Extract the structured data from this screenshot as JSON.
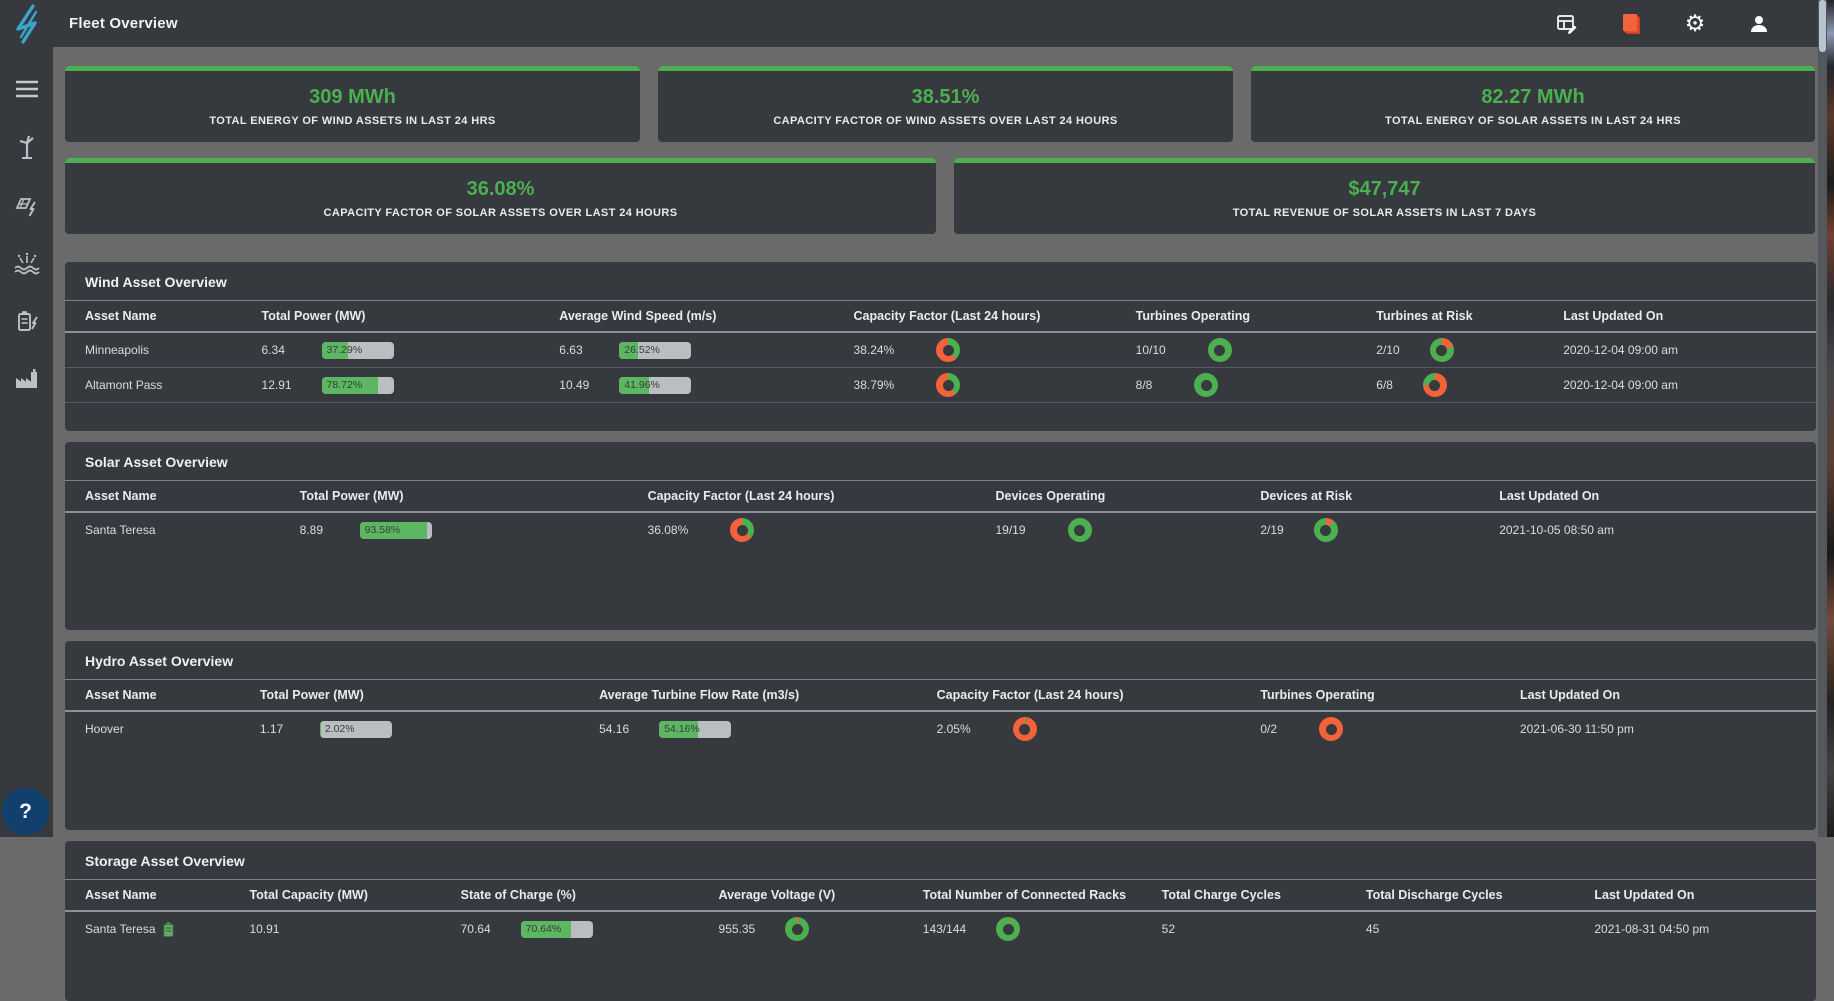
{
  "header": {
    "title": "Fleet Overview"
  },
  "colors": {
    "status_green": "#4caf50",
    "status_orange": "#f4623a",
    "accent_green": "#4caf50",
    "card_bg": "#36393d",
    "page_bg": "#6a6a6a",
    "logo_cyan": "#38a6cc"
  },
  "top_icons": [
    "report-edit",
    "copy-pages",
    "settings-gear",
    "account-person"
  ],
  "sidebar": {
    "items": [
      "menu",
      "wind-assets",
      "solar-assets",
      "hydro-assets",
      "storage-assets",
      "plant-assets"
    ],
    "help_label": "?"
  },
  "kpis": [
    {
      "value": "309 MWh",
      "label": "TOTAL ENERGY OF WIND ASSETS IN LAST 24 HRS"
    },
    {
      "value": "38.51%",
      "label": "CAPACITY FACTOR OF WIND ASSETS OVER LAST 24 HOURS"
    },
    {
      "value": "82.27 MWh",
      "label": "TOTAL ENERGY OF SOLAR ASSETS IN LAST 24 HRS"
    },
    {
      "value": "36.08%",
      "label": "CAPACITY FACTOR OF SOLAR ASSETS OVER LAST 24 HOURS"
    },
    {
      "value": "$47,747",
      "label": "TOTAL REVENUE OF SOLAR ASSETS IN LAST 7 DAYS"
    }
  ],
  "wind_table": {
    "title": "Wind Asset Overview",
    "columns": [
      "Asset Name",
      "Total Power (MW)",
      "Average Wind Speed (m/s)",
      "Capacity Factor (Last 24 hours)",
      "Turbines Operating",
      "Turbines at Risk",
      "Last Updated On"
    ],
    "rows": [
      {
        "asset": "Minneapolis",
        "power": "6.34",
        "power_bar": {
          "pct": 37.29,
          "label": "37.29%"
        },
        "speed": "6.63",
        "speed_bar": {
          "pct": 26.52,
          "label": "26.52%"
        },
        "cf": "38.24%",
        "cf_donut": {
          "green": 38.24
        },
        "operating": "10/10",
        "operating_donut": {
          "green": 100
        },
        "risk": "2/10",
        "risk_donut": {
          "green": 80,
          "orange_first": true
        },
        "updated": "2020-12-04 09:00 am"
      },
      {
        "asset": "Altamont Pass",
        "power": "12.91",
        "power_bar": {
          "pct": 78.72,
          "label": "78.72%"
        },
        "speed": "10.49",
        "speed_bar": {
          "pct": 41.96,
          "label": "41.96%"
        },
        "cf": "38.79%",
        "cf_donut": {
          "green": 38.79
        },
        "operating": "8/8",
        "operating_donut": {
          "green": 100
        },
        "risk": "6/8",
        "risk_donut": {
          "green": 25,
          "orange_first": true
        },
        "updated": "2020-12-04 09:00 am"
      }
    ]
  },
  "solar_table": {
    "title": "Solar Asset Overview",
    "columns": [
      "Asset Name",
      "Total Power (MW)",
      "Capacity Factor (Last 24 hours)",
      "Devices Operating",
      "Devices at Risk",
      "Last Updated On"
    ],
    "rows": [
      {
        "asset": "Santa Teresa",
        "power": "8.89",
        "power_bar": {
          "pct": 93.58,
          "label": "93.58%"
        },
        "cf": "36.08%",
        "cf_donut": {
          "green": 36.08
        },
        "operating": "19/19",
        "operating_donut": {
          "green": 100
        },
        "risk": "2/19",
        "risk_donut": {
          "green": 89.5,
          "orange_first": true
        },
        "updated": "2021-10-05 08:50 am"
      }
    ]
  },
  "hydro_table": {
    "title": "Hydro Asset Overview",
    "columns": [
      "Asset Name",
      "Total Power (MW)",
      "Average Turbine Flow Rate (m3/s)",
      "Capacity Factor (Last 24 hours)",
      "Turbines Operating",
      "Last Updated On"
    ],
    "rows": [
      {
        "asset": "Hoover",
        "power": "1.17",
        "power_bar": {
          "pct": 2.02,
          "label": "2.02%"
        },
        "flow": "54.16",
        "flow_bar": {
          "pct": 54.16,
          "label": "54.16%"
        },
        "cf": "2.05%",
        "cf_donut": {
          "green": 2.05
        },
        "operating": "0/2",
        "operating_donut": {
          "green": 0
        },
        "updated": "2021-06-30 11:50 pm"
      }
    ]
  },
  "storage_table": {
    "title": "Storage Asset Overview",
    "columns": [
      "Asset Name",
      "Total Capacity (MW)",
      "State of Charge (%)",
      "Average Voltage (V)",
      "Total Number of Connected Racks",
      "Total Charge Cycles",
      "Total Discharge Cycles",
      "Last Updated On"
    ],
    "rows": [
      {
        "asset": "Santa Teresa",
        "capacity": "10.91",
        "charge": "70.64",
        "charge_bar": {
          "pct": 70.64,
          "label": "70.64%"
        },
        "voltage": "955.35",
        "voltage_donut": {
          "green": 97,
          "orange_first": true
        },
        "racks": "143/144",
        "racks_donut": {
          "green": 99.3,
          "orange_first": true
        },
        "charge_cycles": "52",
        "discharge_cycles": "45",
        "updated": "2021-08-31 04:50 pm"
      }
    ]
  }
}
